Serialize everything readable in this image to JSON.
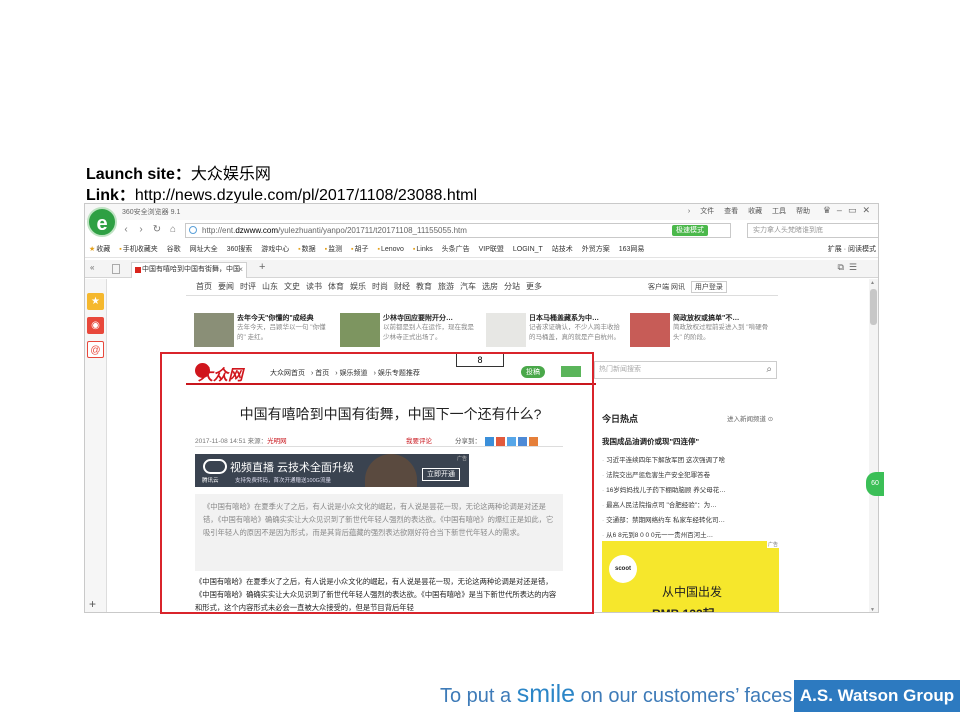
{
  "caption": {
    "site_label": "Launch site：",
    "site_value": "大众娱乐网",
    "link_label": "Link：",
    "link_value": "http://news.dzyule.com/pl/2017/1108/23088.html"
  },
  "browser": {
    "app_title": "360安全浏览器 9.1",
    "menu": [
      "文件",
      "查看",
      "收藏",
      "工具",
      "帮助"
    ],
    "address_prefix": "http://ent.",
    "address_domain": "dzwww.com",
    "address_path": "/yulezhuanti/yanpo/201711/t20171108_11155055.htm",
    "fast_button": "极速模式",
    "search_placeholder": "实力拿人头梵睹谁到底",
    "bookmarks": [
      "收藏",
      "手机收藏夹",
      "谷歌",
      "网址大全",
      "360搜索",
      "游戏中心",
      "数据",
      "监测",
      "胡子",
      "Lenovo",
      "Links",
      "头条广告",
      "VIP联盟",
      "LOGIN_T",
      "站技术",
      "外贸方案",
      "163网易"
    ],
    "bookmark_right": [
      "扩展",
      "阅读模式"
    ],
    "tab_label": "中国有嘻哈到中国有街舞，中国"
  },
  "site": {
    "nav": [
      "首页",
      "要闻",
      "时评",
      "山东",
      "文史",
      "读书",
      "体育",
      "娱乐",
      "时尚",
      "财经",
      "教育",
      "旅游",
      "汽车",
      "选房",
      "分站",
      "更多"
    ],
    "nav_right": [
      "客户端",
      "网讯",
      "用户登录"
    ],
    "promos": [
      {
        "title": "去年今天\"你懂的\"成经典",
        "desc": "去年今天，吕颖华以一句 \"你懂的\" 走红。"
      },
      {
        "title": "少林寺回应要附开分…",
        "desc": "以前都是别人在运作，现在我是少林寺正式出场了。"
      },
      {
        "title": "日本马桶盖藏系为中…",
        "desc": "记者求证确认，不少人跨丰收拾的马桶盖，真的就是产自杭州。"
      },
      {
        "title": "简政放权或搞单\"不…",
        "desc": "简政放权过程前妥进入到 \"啃硬骨头\" 的阶段。"
      }
    ],
    "logo_text": "大众网",
    "breadcrumb": [
      "大众网首页",
      "首页",
      "娱乐频道",
      "娱乐专题推荐"
    ],
    "submit_label": "投稿",
    "search_placeholder": "热门新闻搜索",
    "number_box": "8"
  },
  "article": {
    "headline": "中国有嘻哈到中国有街舞，中国下一个还有什么?",
    "date": "2017-11-08 14:51",
    "source_label": "来源：",
    "source": "光明网",
    "comment": "我要评论",
    "share_label": "分享到：",
    "banner_title": "视频直播 云技术全面升级",
    "banner_brand": "腾讯云",
    "banner_sub": "支持免费转码，首次开通赠送100G流量",
    "banner_btn": "立即开通",
    "banner_tag": "广告",
    "quote": "《中国有嘻哈》在夏季火了之后，有人说是小众文化的崛起，有人说是昙花一现，无论这两种论调是对还是错，《中国有嘻哈》确确实实让大众见识到了新世代年轻人强烈的表达欲。《中国有嘻哈》的爆红正是如此，它吸引年轻人的原因不是因为形式，而是其背后蕴藏的强烈表达欲刚好符合当下新世代年轻人的需求。",
    "body": "《中国有嘻哈》在夏季火了之后，有人说是小众文化的崛起，有人说是昙花一现，无论这两种论调是对还是错，《中国有嘻哈》确确实实让大众见识到了新世代年轻人强烈的表达欲。《中国有嘻哈》是当下新世代所表达的内容和形式，这个内容形式未必会一直被大众接受的，但是节目背后年轻"
  },
  "sidebar_right": {
    "title": "今日热点",
    "more": "进入新闻频道",
    "lead": "我国成品油调价或现\"四连停\"",
    "items": [
      "习近平连续四年下解放军团 这次强调了啥",
      "法院交出严惩危害生产安全犯罪答卷",
      "16岁妈妈找儿子药下棚助脑顾 养父母花…",
      "最高人民法院指点司 \"合肥经验\"：为…",
      "交通部：禁期网络约车 私家车经转化司…",
      "从6 8元到8 0 0 0元一一贵州百河土…"
    ],
    "ad_logo": "scoot",
    "ad_line1": "从中国出发",
    "ad_line2": "RMB 132起",
    "ad_tag": "广告"
  },
  "footer": {
    "slogan_pre": "To put a ",
    "slogan_smile": "smile",
    "slogan_post": " on our customers’ faces",
    "brand": "A.S. Watson Group"
  },
  "colors": {
    "accent_red": "#d9242b",
    "brand_blue": "#2d7ac0",
    "browser_green": "#2ea043"
  }
}
